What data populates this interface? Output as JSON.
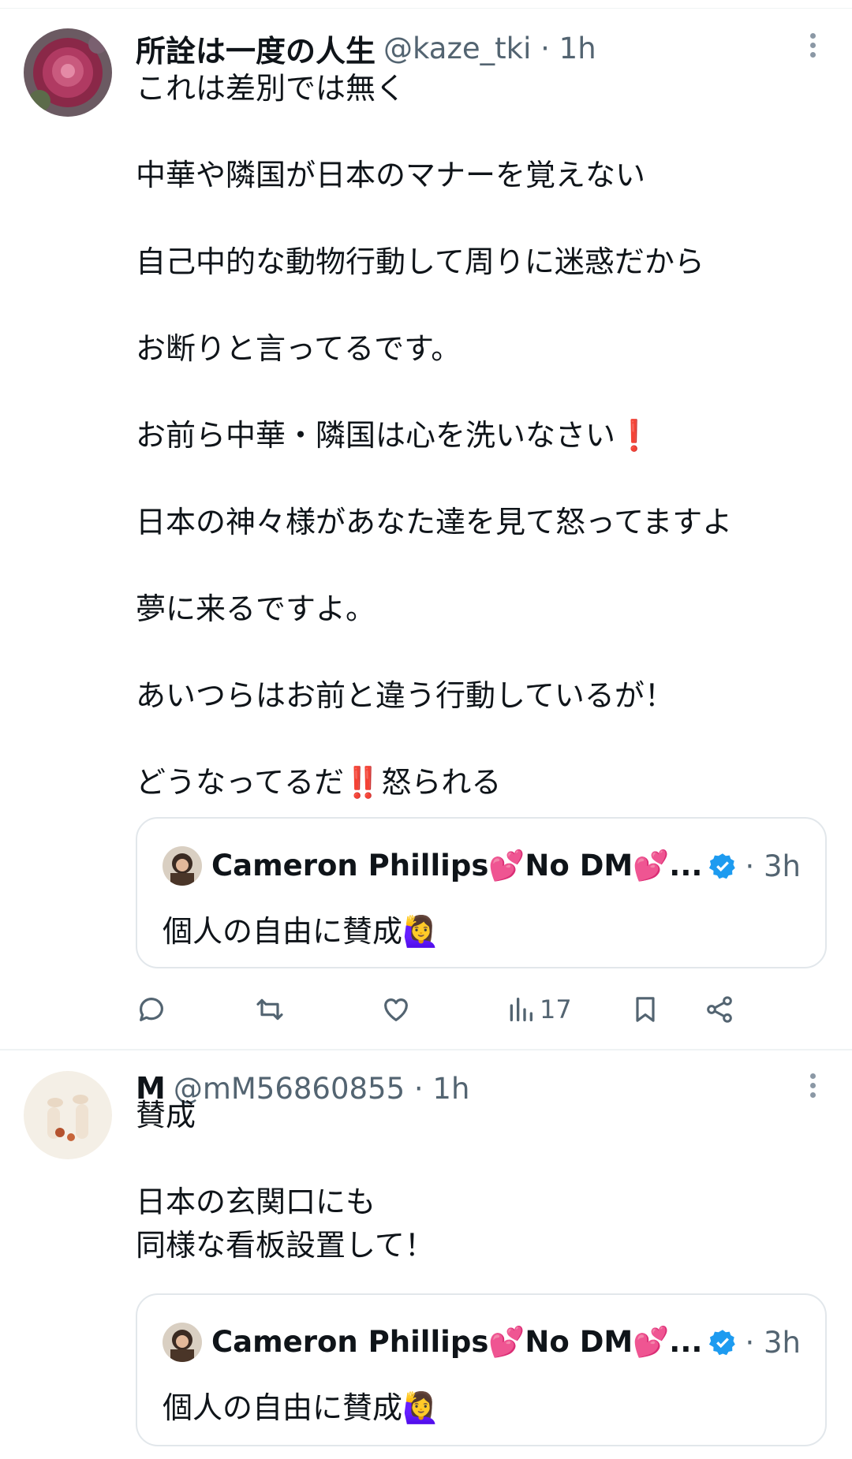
{
  "tweet1": {
    "author_name": "所詮は一度の人生",
    "handle_time": "@kaze_tki · 1h",
    "text": "これは差別では無く\n\n中華や隣国が日本のマナーを覚えない\n\n自己中的な動物行動して周りに迷惑だから\n\nお断りと言ってるです。\n\nお前ら中華・隣国は心を洗いなさい❗\n\n日本の神々様があなた達を見て怒ってますよ\n\n夢に来るですよ。\n\nあいつらはお前と違う行動しているが！\n\nどうなってるだ‼️怒られる",
    "quote": {
      "name": "Cameron Phillips💕No DM💕...",
      "time": "· 3h",
      "text": "個人の自由に賛成🙋‍♀️"
    },
    "views": "17"
  },
  "tweet2": {
    "author_name": "M",
    "handle_time": "@mM56860855 · 1h",
    "text": "賛成\n\n日本の玄関口にも\n同様な看板設置して！",
    "quote": {
      "name": "Cameron Phillips💕No DM💕...",
      "time": "· 3h",
      "text": "個人の自由に賛成🙋‍♀️"
    }
  },
  "colors": {
    "verified": "#1d9bf0",
    "secondary": "#536471",
    "border": "#eff3f4"
  },
  "icons": [
    "more-icon",
    "reply-icon",
    "retweet-icon",
    "like-icon",
    "views-icon",
    "bookmark-icon",
    "share-icon",
    "verified-badge-icon"
  ]
}
